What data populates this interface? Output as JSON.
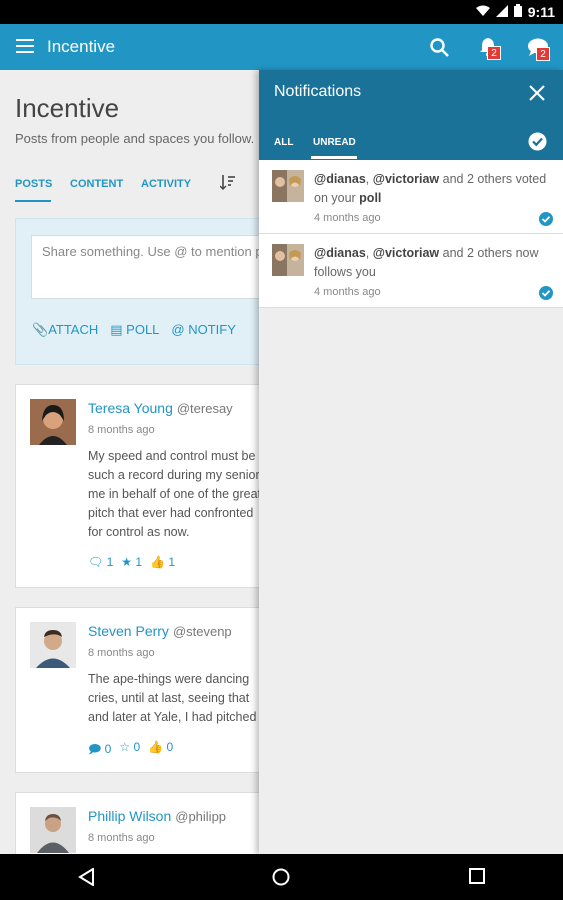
{
  "status_bar": {
    "time": "9:11"
  },
  "app_bar": {
    "title": "Incentive",
    "notifications_badge": "2",
    "messages_badge": "2"
  },
  "main": {
    "title": "Incentive",
    "subtitle": "Posts from people and spaces you follow.",
    "tabs": [
      {
        "label": "POSTS",
        "active": true
      },
      {
        "label": "CONTENT",
        "active": false
      },
      {
        "label": "ACTIVITY",
        "active": false
      }
    ],
    "share": {
      "placeholder": "Share something. Use @ to mention people",
      "attach": "ATTACH",
      "poll": "POLL",
      "notify": "NOTIFY"
    },
    "posts": [
      {
        "name": "Teresa Young",
        "handle": "@teresay",
        "time": "8 months ago",
        "body": [
          "My speed and control must be",
          "such a record during my senior",
          "me in behalf of one of the great",
          "pitch that ever had confronted",
          "for control as now."
        ],
        "comments": "1",
        "stars": "1",
        "likes": "1"
      },
      {
        "name": "Steven Perry",
        "handle": "@stevenp",
        "time": "8 months ago",
        "body": [
          "The ape-things were dancing",
          "cries, until at last, seeing that",
          "and later at Yale, I had pitched"
        ],
        "comments": "0",
        "stars": "0",
        "likes": "0"
      },
      {
        "name": "Phillip Wilson",
        "handle": "@philipp",
        "time": "8 months ago"
      }
    ]
  },
  "notifications": {
    "title": "Notifications",
    "tab_all": "ALL",
    "tab_unread": "UNREAD",
    "items": [
      {
        "user1": "@dianas",
        "sep": ", ",
        "user2": "@victoriaw",
        "text": " and 2 others voted on your ",
        "target": "poll",
        "time": "4 months ago"
      },
      {
        "user1": "@dianas",
        "sep": ", ",
        "user2": "@victoriaw",
        "text": " and 2 others now follows you",
        "target": "",
        "time": "4 months ago"
      }
    ]
  },
  "colors": {
    "app_bar": "#2196c4",
    "notif_header": "#1b7299",
    "accent": "#2196c4",
    "badge": "#e53935"
  }
}
